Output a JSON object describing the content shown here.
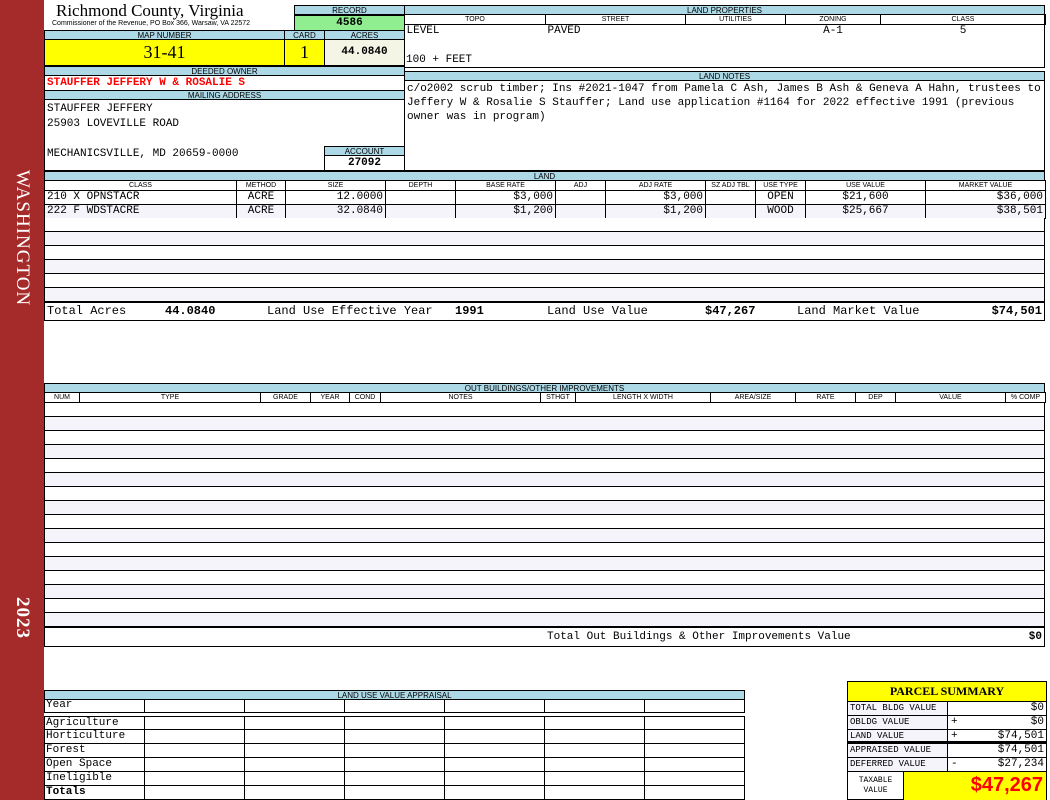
{
  "sidebar": {
    "district": "WASHINGTON",
    "year": "2023"
  },
  "header": {
    "county": "Richmond County, Virginia",
    "office": "Commissioner of the Revenue, PO Box 366, Warsaw, VA 22572"
  },
  "record": {
    "label": "RECORD",
    "value": "4586"
  },
  "map": {
    "map_label": "MAP NUMBER",
    "map_value": "31-41",
    "card_label": "CARD",
    "card_value": "1",
    "acres_label": "ACRES",
    "acres_value": "44.0840"
  },
  "owner": {
    "label": "DEEDED OWNER",
    "name": "STAUFFER JEFFERY W & ROSALIE S",
    "mailing_label": "MAILING ADDRESS",
    "address": [
      "STAUFFER JEFFERY",
      "25903 LOVEVILLE ROAD",
      "",
      "MECHANICSVILLE, MD 20659-0000"
    ],
    "account_label": "ACCOUNT",
    "account_value": "27092"
  },
  "land_properties": {
    "label": "LAND PROPERTIES",
    "headers": [
      "TOPO",
      "STREET",
      "UTILITIES",
      "ZONING",
      "CLASS"
    ],
    "values": [
      "LEVEL",
      "PAVED",
      "",
      "A-1",
      "5"
    ],
    "frontage": "100 + FEET"
  },
  "land_notes": {
    "label": "LAND NOTES",
    "text": "c/o2002 scrub timber; Ins #2021-1047 from Pamela C Ash, James B Ash & Geneva A Hahn, trustees to Jeffery W & Rosalie S Stauffer; Land use application #1164 for 2022 effective 1991 (previous owner was in program)"
  },
  "land": {
    "label": "LAND",
    "headers": [
      "CLASS",
      "METHOD",
      "SIZE",
      "DEPTH",
      "BASE RATE",
      "ADJ",
      "ADJ RATE",
      "SZ ADJ TBL",
      "USE TYPE",
      "USE VALUE",
      "MARKET VALUE"
    ],
    "rows": [
      [
        "210 X OPNSTACR",
        "ACRE",
        "12.0000",
        "",
        "$3,000",
        "",
        "$3,000",
        "",
        "OPEN",
        "$21,600",
        "$36,000"
      ],
      [
        "222 F WDSTACRE",
        "ACRE",
        "32.0840",
        "",
        "$1,200",
        "",
        "$1,200",
        "",
        "WOOD",
        "$25,667",
        "$38,501"
      ]
    ],
    "total_acres_label": "Total Acres",
    "total_acres": "44.0840",
    "effective_year_label": "Land Use Effective Year",
    "effective_year": "1991",
    "use_value_label": "Land Use Value",
    "use_value": "$47,267",
    "market_value_label": "Land Market Value",
    "market_value": "$74,501"
  },
  "outbuildings": {
    "label": "OUT BUILDINGS/OTHER IMPROVEMENTS",
    "headers": [
      "NUM",
      "TYPE",
      "GRADE",
      "YEAR",
      "COND",
      "NOTES",
      "STHGT",
      "LENGTH X WIDTH",
      "AREA/SIZE",
      "RATE",
      "DEP",
      "VALUE",
      "% COMP"
    ],
    "total_label": "Total Out Buildings & Other Improvements Value",
    "total_value": "$0"
  },
  "land_use_appraisal": {
    "label": "LAND USE VALUE APPRAISAL",
    "year_label": "Year",
    "rows": [
      "Agriculture",
      "Horticulture",
      "Forest",
      "Open Space",
      "Ineligible"
    ],
    "totals_label": "Totals"
  },
  "parcel_summary": {
    "title": "PARCEL SUMMARY",
    "rows": [
      {
        "label": "TOTAL BLDG VALUE",
        "sign": "",
        "value": "$0"
      },
      {
        "label": "OBLDG VALUE",
        "sign": "+",
        "value": "$0"
      },
      {
        "label": "LAND VALUE",
        "sign": "+",
        "value": "$74,501"
      },
      {
        "label": "APPRAISED VALUE",
        "sign": "",
        "value": "$74,501"
      },
      {
        "label": "DEFERRED VALUE",
        "sign": "-",
        "value": "$27,234"
      }
    ],
    "taxable_label": "TAXABLE VALUE",
    "taxable_value": "$47,267"
  },
  "colors": {
    "sidebar": "#a52a2a",
    "header_blue": "#add8e6",
    "highlight_yellow": "#ffff00",
    "record_green": "#90ee90",
    "owner_red": "#ff0000"
  }
}
